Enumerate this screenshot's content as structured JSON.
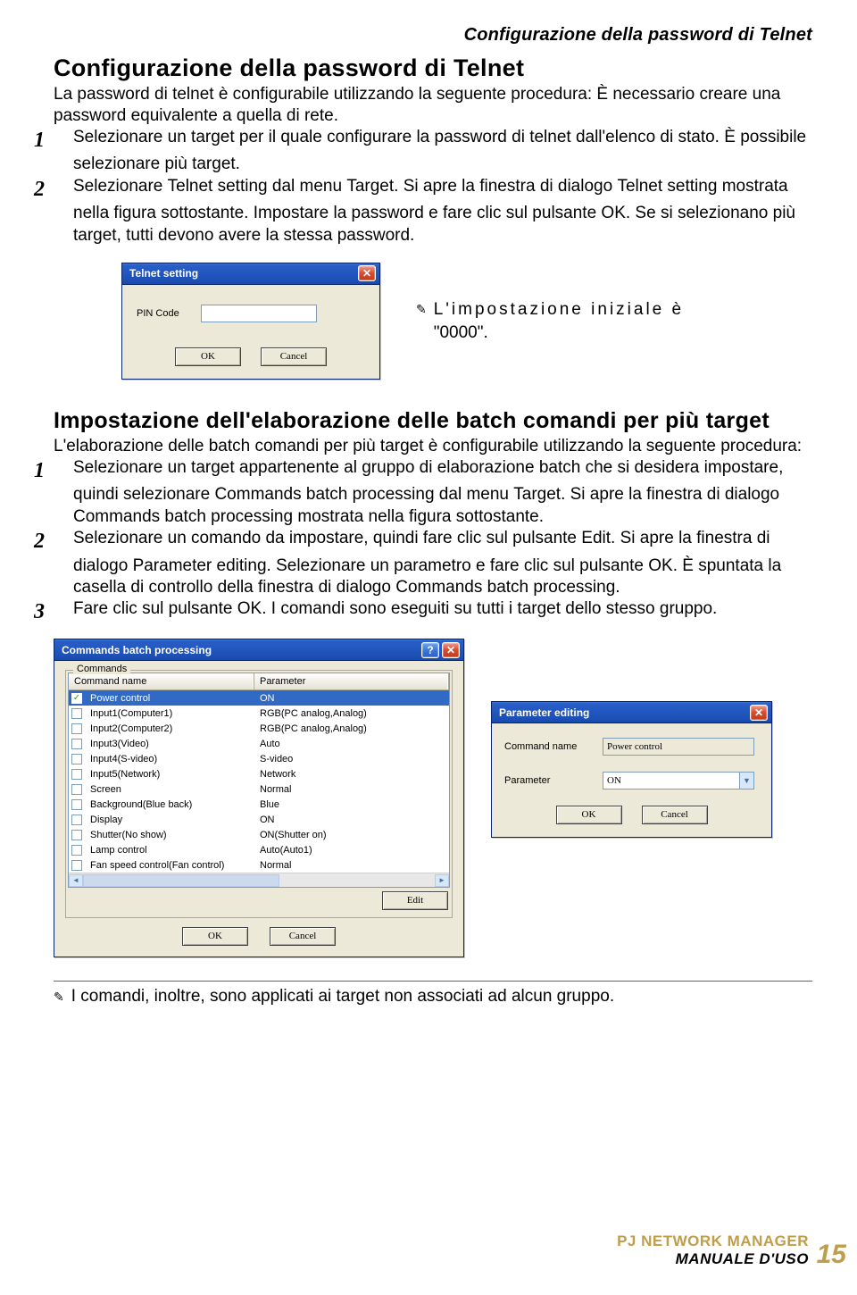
{
  "header": {
    "running_title": "Configurazione della password di Telnet"
  },
  "section1": {
    "title": "Configurazione della password di Telnet",
    "intro": "La password di telnet è configurabile utilizzando la seguente procedura: È necessario creare una password equivalente a quella di rete.",
    "step1_a": "Selezionare un target per il quale configurare la password di telnet dall'elenco di stato. È possibile selezionare più target.",
    "step2_a": "Selezionare ",
    "step2_b": "Telnet setting",
    "step2_c": " dal menu ",
    "step2_d": "Target",
    "step2_e": ". Si apre la finestra di dialogo ",
    "step2_f": "Telnet setting",
    "step2_g": " mostrata nella figura sottostante. Impostare la password e fare clic sul pulsante ",
    "step2_h": "OK",
    "step2_i": ". Se si selezionano più target, tutti devono avere la stessa password.",
    "note_a": "L'impostazione iniziale è",
    "note_b": "\"0000\"."
  },
  "telnet_dialog": {
    "title": "Telnet setting",
    "pin_label": "PIN Code",
    "pin_value": "",
    "ok": "OK",
    "cancel": "Cancel"
  },
  "section2": {
    "title": "Impostazione dell'elaborazione delle batch comandi per più target",
    "intro": "L'elaborazione delle batch comandi per più target è configurabile utilizzando la seguente procedura:",
    "s1a": "Selezionare un target appartenente al gruppo di elaborazione batch che si desidera impostare, quindi selezionare ",
    "s1b": "Commands batch processing",
    "s1c": " dal menu ",
    "s1d": "Target",
    "s1e": ". Si apre la finestra di dialogo ",
    "s1f": "Commands batch processing",
    "s1g": " mostrata nella figura sottostante.",
    "s2a": "Selezionare un comando da impostare, quindi fare clic sul pulsante ",
    "s2b": "Edit",
    "s2c": ". Si apre la finestra di dialogo ",
    "s2d": "Parameter editing",
    "s2e": ". Selezionare un parametro e fare clic sul pulsante ",
    "s2f": "OK",
    "s2g": ". È spuntata la casella di controllo della finestra di dialogo ",
    "s2h": "Commands batch processing",
    "s2i": ".",
    "s3a": "Fare clic sul pulsante ",
    "s3b": "OK",
    "s3c": ". I comandi sono eseguiti su tutti i target dello stesso gruppo."
  },
  "batch_dialog": {
    "title": "Commands batch processing",
    "legend": "Commands",
    "col_name": "Command name",
    "col_param": "Parameter",
    "rows": [
      {
        "checked": true,
        "name": "Power control",
        "param": "ON"
      },
      {
        "checked": false,
        "name": "Input1(Computer1)",
        "param": "RGB(PC analog,Analog)"
      },
      {
        "checked": false,
        "name": "Input2(Computer2)",
        "param": "RGB(PC analog,Analog)"
      },
      {
        "checked": false,
        "name": "Input3(Video)",
        "param": "Auto"
      },
      {
        "checked": false,
        "name": "Input4(S-video)",
        "param": "S-video"
      },
      {
        "checked": false,
        "name": "Input5(Network)",
        "param": "Network"
      },
      {
        "checked": false,
        "name": "Screen",
        "param": "Normal"
      },
      {
        "checked": false,
        "name": "Background(Blue back)",
        "param": "Blue"
      },
      {
        "checked": false,
        "name": "Display",
        "param": "ON"
      },
      {
        "checked": false,
        "name": "Shutter(No show)",
        "param": "ON(Shutter on)"
      },
      {
        "checked": false,
        "name": "Lamp control",
        "param": "Auto(Auto1)"
      },
      {
        "checked": false,
        "name": "Fan speed control(Fan control)",
        "param": "Normal"
      }
    ],
    "edit": "Edit",
    "ok": "OK",
    "cancel": "Cancel"
  },
  "param_dialog": {
    "title": "Parameter editing",
    "cmd_label": "Command name",
    "cmd_value": "Power control",
    "param_label": "Parameter",
    "param_value": "ON",
    "ok": "OK",
    "cancel": "Cancel"
  },
  "footer": {
    "note": "I comandi, inoltre, sono applicati ai target non associati ad alcun gruppo.",
    "brand1": "PJ NETWORK MANAGER",
    "brand2": "MANUALE D'USO",
    "page": "15"
  }
}
